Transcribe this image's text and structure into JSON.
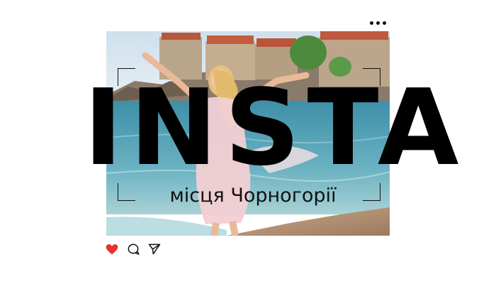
{
  "post": {
    "title": "INSTA",
    "subtitle": "місця Чорногорії"
  },
  "icons": {
    "menu": "more-dots-icon",
    "like": "heart-icon",
    "comment": "comment-icon",
    "share": "share-icon"
  },
  "colors": {
    "heart": "#e8312f",
    "text": "#000000",
    "sea": "#4fa3b8",
    "sky": "#d8e6f0"
  }
}
